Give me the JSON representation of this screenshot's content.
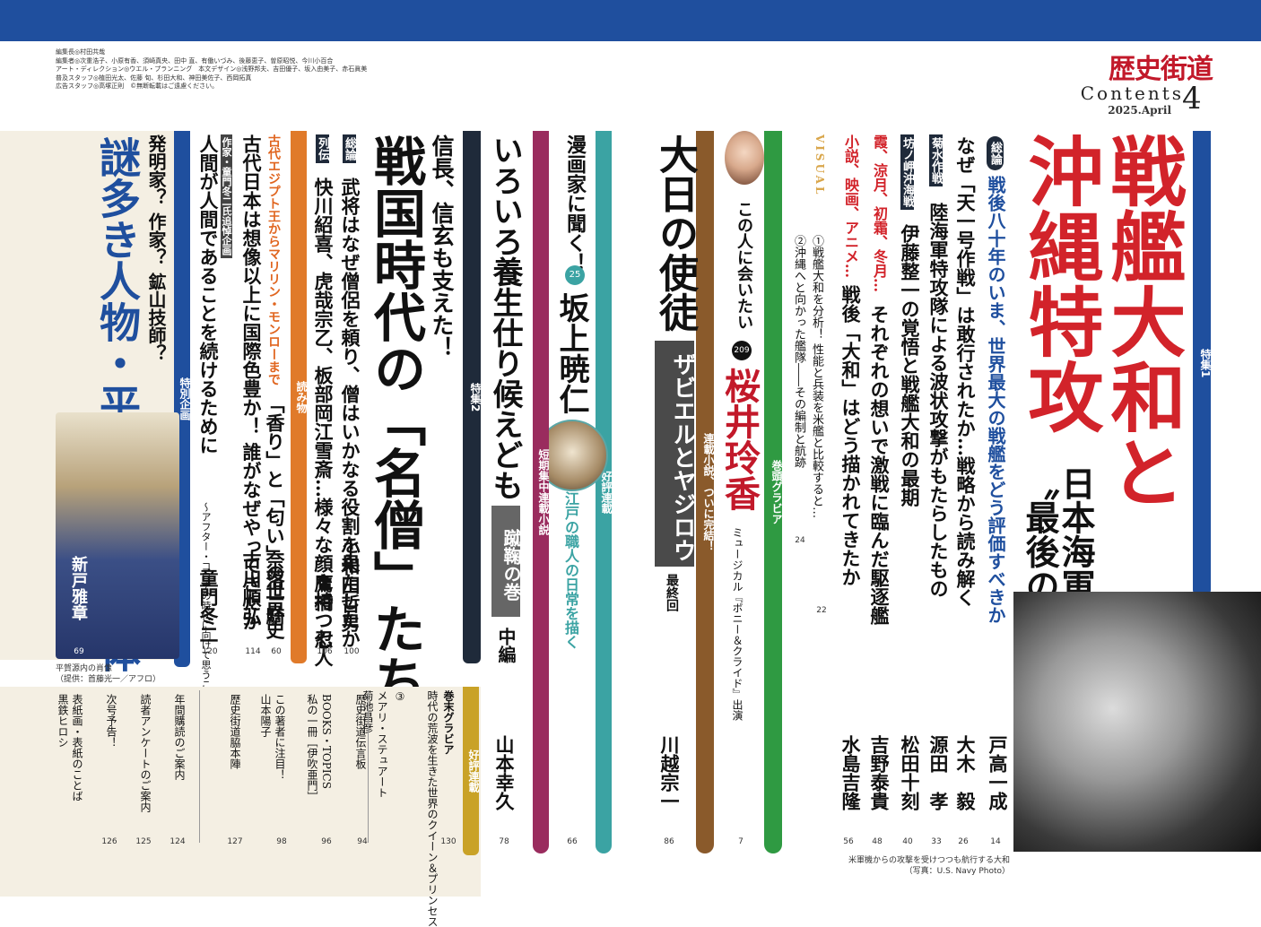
{
  "magazine": {
    "logo": "歴史街道",
    "contents_label": "Contents",
    "issue_number": "4",
    "date": "2025.April"
  },
  "credits": [
    "編集長◎村田共哉",
    "編集者◎次重浩子、小原有香、須崎真央、田中 直、有働いづみ、後藤恵子、曽原昭悦、今川小百合",
    "アート・ディレクション◎ウエル・プランニング　本文デザイン◎浅野邦夫、吉田優子、坂入由美子、赤石眞美",
    "普及スタッフ◎植田光太、佐藤 旬、杉田大和、神田美佐子、西岡拓真",
    "広告スタッフ◎高塚正則　©無断転載はご遠慮ください。"
  ],
  "feature1": {
    "tag": "特集1",
    "title_line1": "戦艦大和と",
    "title_line2": "沖縄特攻",
    "subtitle_a": "日本海軍",
    "subtitle_b": "〝最後の出撃〟",
    "sokatsu_label": "総論",
    "sokatsu_head": "戦後八十年のいま、世界最大の戦艦をどう評価すべきか",
    "item1_text": "なぜ「天一号作戦」は敢行されたか…戦略から読み解く",
    "item1_author": "戸高一成",
    "item1_page": "14",
    "item2_text": "陸海軍特攻隊による波状攻撃がもたらしたもの",
    "item2_author": "大木　毅",
    "item2_page": "26",
    "kikusui_label": "菊水作戦",
    "item3_author": "源田　孝",
    "item3_page": "33",
    "bonomisaki_label": "坊ノ岬沖海戦",
    "item4_text": "伊藤整一の覚悟と戦艦大和の最期",
    "item4_author": "松田十刻",
    "item4_page": "40",
    "item5_head": "霞、涼月、初霜、冬月…",
    "item5_text": "それぞれの想いで激戦に臨んだ駆逐艦",
    "item5_author": "吉野泰貴",
    "item5_page": "48",
    "item6_head": "小説、映画、アニメ…",
    "item6_text": "戦後「大和」はどう描かれてきたか",
    "item6_author": "水島吉隆",
    "item6_page": "56",
    "visual_label": "VISUAL",
    "visual1_text": "①戦艦大和を分析！ 性能と兵装を米艦と比較すると…",
    "visual1_page": "22",
    "visual2_text": "②沖縄へと向かった艦隊――その編制と航跡",
    "visual2_page": "24"
  },
  "photo_caption_line1": "米軍機からの攻撃を受けつつも航行する大和",
  "photo_caption_line2": "（写真：U.S. Navy Photo）",
  "gravure": {
    "tag": "巻頭グラビア",
    "series": "この人に会いたい",
    "number": "209",
    "name": "桜井玲香",
    "note": "ミュージカル『ボニー＆クライド』出演",
    "page": "7"
  },
  "novel": {
    "tag": "連載小説、ついに完結！",
    "title": "大日の使徒",
    "subtitle": "ザビエルとヤジロウ",
    "final": "最終回",
    "author": "川越宗一",
    "page": "86"
  },
  "manga": {
    "tag": "好評連載",
    "series": "漫画家に聞く！",
    "number": "25",
    "name": "坂上暁仁",
    "caption": "江戸の職人の日常を描く",
    "page": "66"
  },
  "short_story": {
    "tag": "短期集中連載小説",
    "title": "いろいろ養生仕り候えども",
    "chapter": "蹴鞠の巻",
    "part": "中編",
    "author": "山本幸久",
    "page": "78"
  },
  "feature2": {
    "tag": "特集2",
    "lead": "信長、信玄も支えた！",
    "title": "戦国時代の「名僧」たち",
    "sokatsu_label": "総論",
    "sokatsu_text": "武将はなぜ僧侶を頼り、僧はいかなる役割を果たしたか",
    "sokatsu_author": "小和田哲男",
    "sokatsu_page": "100",
    "retsuden_label": "列伝",
    "retsuden_text": "快川紹喜、虎哉宗乙、板部岡江雪斎…様々な顔を持つ七人",
    "retsuden_author": "鷹橋　忍",
    "retsuden_page": "106"
  },
  "reading": {
    "tag": "読み物",
    "item1_head": "古代エジプト王からマリリン・モンローまで",
    "item1_text": "「香り」と「匂い」の世界史",
    "item1_author": "奈落一騎",
    "item1_page": "60",
    "item2_text": "古代日本は想像以上に国際色豊か！ 誰がなぜやってきたか",
    "item2_author": "古川順弘",
    "item2_page": "114",
    "item3_label": "作家・童門冬二氏追悼企画",
    "item3_text": "人間が人間であることを続けるために",
    "item3_sub": "〜アフター・コロナの時代に向けて思うこと〜",
    "item3_author": "童門冬二",
    "item3_page": "120"
  },
  "special": {
    "tag": "特別企画",
    "lead": "発明家？ 作家？ 鉱山技師？",
    "title": "謎多き人物・平賀源内の正体",
    "author": "新戸雅章",
    "page": "69"
  },
  "portrait_caption_line1": "平賀源内の肖像",
  "portrait_caption_line2": "（提供：首藤光一／アフロ）",
  "small_items": {
    "tag": "好評連載",
    "gravure_label": "巻末グラビア",
    "gravure_text": "時代の荒波を生きた世界のクイーン＆プリンセス",
    "gravure_number": "③",
    "gravure_sub": "メアリ・ステュアート",
    "gravure_author": "菊池昌彦",
    "gravure_page": "130",
    "dengon": "歴史街道伝言板",
    "dengon_page": "94",
    "books": "BOOKS・TOPICS",
    "books_sub": "私の一冊［伊吹亜門］",
    "books_page": "96",
    "chosha": "この著者に注目！",
    "chosha_sub": "山本陽子",
    "chosha_page": "98",
    "wakihonjin": "歴史街道脇本陣",
    "wakihonjin_page": "127",
    "nenkan": "年間購読のご案内",
    "nenkan_page": "124",
    "enquete": "読者アンケートのご案内",
    "enquete_page": "125",
    "jigou": "次号予告！",
    "jigou_page": "126",
    "hyoshi": "表紙画・表紙のことば",
    "hyoshi_sub": "黒鉄ヒロシ"
  }
}
